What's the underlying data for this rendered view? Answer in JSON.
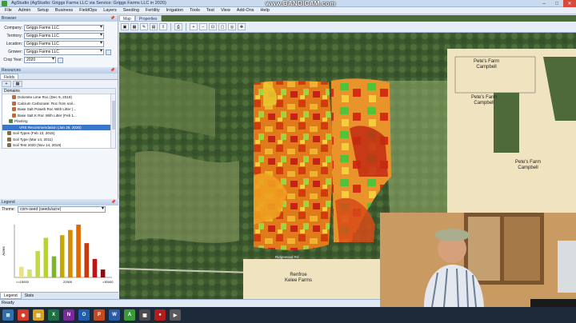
{
  "window": {
    "title": "AgStudio (AgStudio: Griggs Farms LLC via Service: Griggs Farms LLC in 2020)",
    "watermark": "www.BANDICAM.com",
    "controls": [
      "–",
      "□",
      "✕"
    ]
  },
  "menu": [
    "File",
    "Admin",
    "Setup",
    "Business",
    "FieldOps",
    "Layers",
    "Seeding",
    "Fertility",
    "Irrigation",
    "Tools",
    "Test",
    "View",
    "Add-Ons",
    "Help"
  ],
  "left": {
    "browser_header": "Browser",
    "fields": [
      {
        "label": "Company:",
        "value": "Griggs Farms LLC"
      },
      {
        "label": "Territory:",
        "value": "Griggs Farms LLC"
      },
      {
        "label": "Location:",
        "value": "Griggs Farms LLC"
      },
      {
        "label": "Grower:",
        "value": "Griggs Farms LLC"
      },
      {
        "label": "Crop Year:",
        "value": "2020"
      }
    ],
    "resources_header": "Resources",
    "tabs": [
      "Fields"
    ],
    "tree_header": "Domains",
    "tree_nodes": [
      {
        "text": "Dolomite Lime Roc (Dec 9, 2019)",
        "indent": 12,
        "color": "#c9673a"
      },
      {
        "text": "Calcium Carbonate: Roc from soil...",
        "indent": 12,
        "color": "#c9673a"
      },
      {
        "text": "Base Salt Potash Roc With Litter (...",
        "indent": 12,
        "color": "#c9673a"
      },
      {
        "text": "Base Salt K Roc With Litter (Feb 1...",
        "indent": 12,
        "color": "#c9673a"
      },
      {
        "text": "Planting",
        "indent": 8,
        "color": "#4f8c3b"
      },
      {
        "text": "VRS Recommendation (Jan 28, 2020)",
        "indent": 14,
        "color": "#3a77c8",
        "selected": true
      },
      {
        "text": "Soil Types (Feb 13, 2015)",
        "indent": 6,
        "color": "#8c6a3b"
      },
      {
        "text": "Soil Type (Mar 14, 2011)",
        "indent": 6,
        "color": "#8c6a3b"
      },
      {
        "text": "Soil Test 2020 (Nov 14, 2019)",
        "indent": 6,
        "color": "#8c6a3b"
      }
    ]
  },
  "legend": {
    "header": "Legend",
    "theme_label": "Theme:",
    "theme_value": "corn-seed (seeds/acre)",
    "tabs": [
      "Legend",
      "Stats"
    ]
  },
  "chart_data": {
    "type": "bar",
    "ylabel": "Acres",
    "xticks": [
      "<=15000",
      "22500",
      ">30000"
    ],
    "bars": [
      {
        "value": 2,
        "color": "#e8e08a"
      },
      {
        "value": 1.5,
        "color": "#d7e070"
      },
      {
        "value": 5,
        "color": "#c6d84a"
      },
      {
        "value": 7.5,
        "color": "#b8d428"
      },
      {
        "value": 4,
        "color": "#7ab82a"
      },
      {
        "value": 8,
        "color": "#c8a800"
      },
      {
        "value": 9,
        "color": "#d88a00"
      },
      {
        "value": 10,
        "color": "#e06a00"
      },
      {
        "value": 6.5,
        "color": "#c83a10"
      },
      {
        "value": 3.5,
        "color": "#b81818"
      },
      {
        "value": 1.5,
        "color": "#8a1010"
      }
    ]
  },
  "map": {
    "tabs": [
      "Map",
      "Properties"
    ],
    "labels": [
      {
        "text": "Pete's Farm\nCampbell"
      },
      {
        "text": "Pete's Farm\nCampbell"
      },
      {
        "text": "Pete's Farm\nCampbell"
      },
      {
        "text": "Renfroe\nKelee Farms"
      }
    ],
    "road": "Ridgewood Rd"
  },
  "status": "Ready",
  "taskbar_icons": [
    {
      "name": "start-icon",
      "color": "#2f6fb0",
      "glyph": "⊞"
    },
    {
      "name": "chrome-icon",
      "color": "#d83b2a",
      "glyph": "◉"
    },
    {
      "name": "folder-icon",
      "color": "#d9a321",
      "glyph": "▤"
    },
    {
      "name": "excel-icon",
      "color": "#1d7044",
      "glyph": "X"
    },
    {
      "name": "onenote-icon",
      "color": "#7a2a9a",
      "glyph": "N"
    },
    {
      "name": "outlook-icon",
      "color": "#1f5fb0",
      "glyph": "O"
    },
    {
      "name": "powerpoint-icon",
      "color": "#c44a22",
      "glyph": "P"
    },
    {
      "name": "word-icon",
      "color": "#2a5caa",
      "glyph": "W"
    },
    {
      "name": "agstudio-icon",
      "color": "#3a9d3a",
      "glyph": "A"
    },
    {
      "name": "app-icon",
      "color": "#4a4a4a",
      "glyph": "▣"
    },
    {
      "name": "bandicam-icon",
      "color": "#b21e1e",
      "glyph": "●"
    },
    {
      "name": "video-icon",
      "color": "#5a5a5a",
      "glyph": "▶"
    }
  ]
}
